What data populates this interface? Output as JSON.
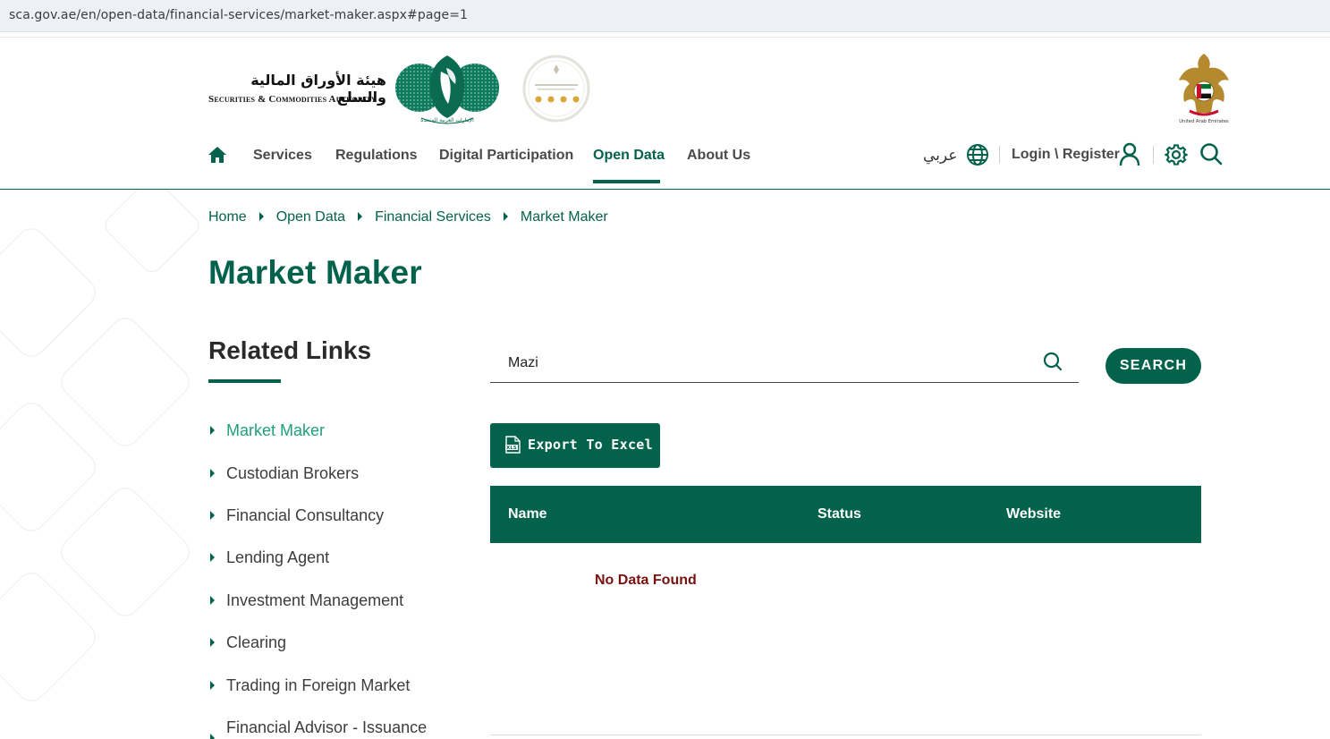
{
  "browser": {
    "url": "sca.gov.ae/en/open-data/financial-services/market-maker.aspx#page=1"
  },
  "header": {
    "logo_ar": "هيئة الأوراق المالية والسلع",
    "logo_en": "Securities & Commodities Authority",
    "emblem_caption": "الإمارات العربية المتحدة",
    "uae_label": "United Arab Emirates",
    "brand_color": "#03624c"
  },
  "nav": {
    "items": [
      {
        "label": "Services"
      },
      {
        "label": "Regulations"
      },
      {
        "label": "Digital Participation"
      },
      {
        "label": "Open Data",
        "active": true
      },
      {
        "label": "About Us"
      }
    ],
    "lang_label": "عربي",
    "login_label": "Login \\ Register"
  },
  "breadcrumb": [
    "Home",
    "Open Data",
    "Financial Services",
    "Market Maker"
  ],
  "page_title": "Market Maker",
  "related": {
    "title": "Related Links",
    "items": [
      {
        "label": "Market Maker",
        "active": true
      },
      {
        "label": "Custodian Brokers"
      },
      {
        "label": "Financial Consultancy"
      },
      {
        "label": "Lending Agent"
      },
      {
        "label": "Investment Management"
      },
      {
        "label": "Clearing"
      },
      {
        "label": "Trading in Foreign Market"
      },
      {
        "label": "Financial Advisor - Issuance"
      }
    ]
  },
  "search": {
    "value": "Mazi",
    "button_label": "SEARCH"
  },
  "export": {
    "label": "Export To Excel",
    "icon_text": "XLS"
  },
  "table": {
    "columns": [
      "Name",
      "Status",
      "Website"
    ],
    "empty_message": "No Data Found"
  }
}
